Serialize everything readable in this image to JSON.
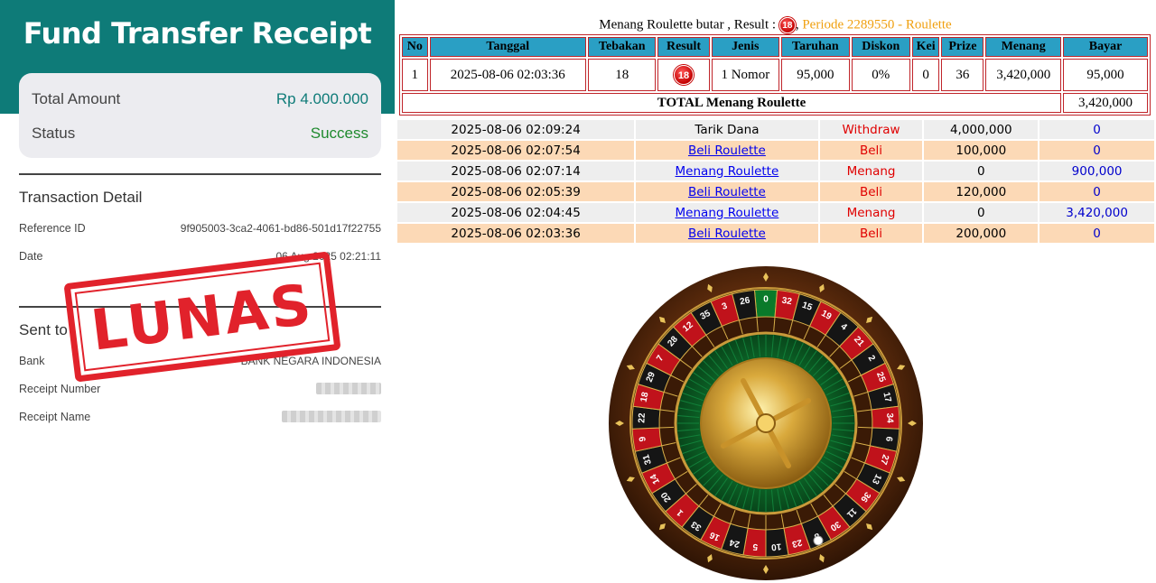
{
  "receipt": {
    "title": "Fund Transfer Receipt",
    "total_amount_label": "Total Amount",
    "total_amount_value": "Rp 4.000.000",
    "status_label": "Status",
    "status_value": "Success",
    "transaction_detail_heading": "Transaction Detail",
    "reference_label": "Reference ID",
    "reference_value": "9f905003-3ca2-4061-bd86-501d17f22755",
    "date_label": "Date",
    "date_value": "06 Aug 2025 02:21:11",
    "sent_to_heading": "Sent to",
    "bank_label": "Bank",
    "bank_value": "BANK NEGARA INDONESIA",
    "receipt_number_label": "Receipt Number",
    "receipt_name_label": "Receipt Name",
    "stamp_text": "LUNAS",
    "colors": {
      "header": "#0e7b78",
      "stamp": "#e1222b",
      "success": "#1f8a2e"
    }
  },
  "game": {
    "headline_prefix": "Menang Roulette butar , Result :",
    "result_number": "18",
    "headline_period": "Periode 2289550 - Roulette",
    "bet_table": {
      "headers": [
        "No",
        "Tanggal",
        "Tebakan",
        "Result",
        "Jenis",
        "Taruhan",
        "Diskon",
        "Kei",
        "Prize",
        "Menang",
        "Bayar"
      ],
      "row": [
        "1",
        "2025-08-06 02:03:36",
        "18",
        "18",
        "1 Nomor",
        "95,000",
        "0%",
        "0",
        "36",
        "3,420,000",
        "95,000"
      ],
      "total_label": "TOTAL  Menang Roulette",
      "total_value": "3,420,000"
    },
    "history": [
      {
        "time": "2025-08-06 02:09:24",
        "desc": "Tarik Dana",
        "type": "Withdraw",
        "amount": "4,000,000",
        "bayar": "0"
      },
      {
        "time": "2025-08-06 02:07:54",
        "desc": "Beli Roulette",
        "type": "Beli",
        "amount": "100,000",
        "bayar": "0"
      },
      {
        "time": "2025-08-06 02:07:14",
        "desc": "Menang Roulette",
        "type": "Menang",
        "amount": "0",
        "bayar": "900,000"
      },
      {
        "time": "2025-08-06 02:05:39",
        "desc": "Beli Roulette",
        "type": "Beli",
        "amount": "120,000",
        "bayar": "0"
      },
      {
        "time": "2025-08-06 02:04:45",
        "desc": "Menang Roulette",
        "type": "Menang",
        "amount": "0",
        "bayar": "3,420,000"
      },
      {
        "time": "2025-08-06 02:03:36",
        "desc": "Beli Roulette",
        "type": "Beli",
        "amount": "200,000",
        "bayar": "0"
      }
    ],
    "wheel_numbers": [
      "0",
      "32",
      "15",
      "19",
      "4",
      "21",
      "2",
      "25",
      "17",
      "34",
      "6",
      "27",
      "13",
      "36",
      "11",
      "30",
      "8",
      "23",
      "10",
      "5",
      "24",
      "16",
      "33",
      "1",
      "20",
      "14",
      "31",
      "9",
      "22",
      "18",
      "29",
      "7",
      "28",
      "12",
      "35",
      "3",
      "26"
    ],
    "colors": {
      "table_header": "#2a9fc4",
      "table_border": "#c0252a",
      "row_odd": "#eeeeee",
      "row_even": "#fcd9b6",
      "period": "#f0a010"
    }
  }
}
